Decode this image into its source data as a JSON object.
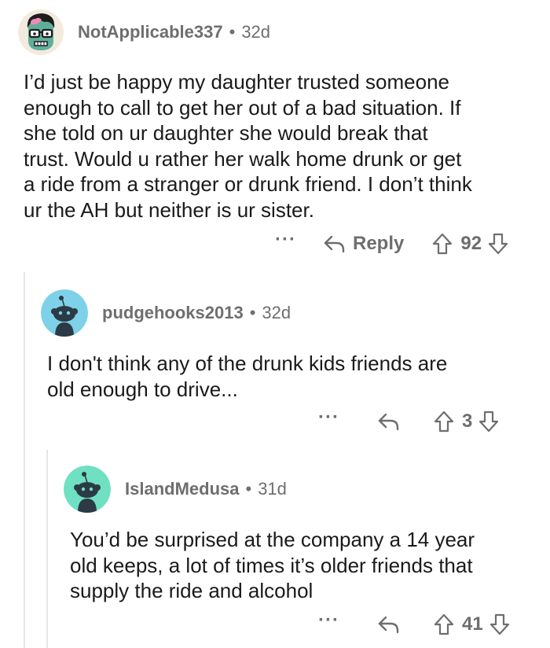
{
  "comments": [
    {
      "username": "NotApplicable337",
      "separator": "•",
      "age": "32d",
      "body": "I’d just be happy my daughter trusted someone\nenough to call to get her out of a bad situation. If\nshe told on ur daughter she would break that\ntrust. Would u rather her walk home drunk or get\na ride from a stranger or drunk friend. I don’t think\nur the AH but neither is ur sister.",
      "more": "···",
      "reply_label": "Reply",
      "score": "92",
      "avatar": "zombie-avatar",
      "avatar_bg": "#f2eadd"
    },
    {
      "username": "pudgehooks2013",
      "separator": "•",
      "age": "32d",
      "body": "I don't think any of the drunk kids friends are\nold enough to drive...",
      "more": "···",
      "score": "3",
      "avatar": "snoo-avatar",
      "avatar_bg": "#7ed1e8"
    },
    {
      "username": "IslandMedusa",
      "separator": "•",
      "age": "31d",
      "body": "You’d be surprised at the company a 14 year\nold keeps, a lot of times it’s older friends that\nsupply the ride and alcohol",
      "more": "···",
      "score": "41",
      "avatar": "snoo-avatar",
      "avatar_bg": "#6fe0c2"
    }
  ],
  "colors": {
    "text": "#1a1a1b",
    "meta": "#6e6e70",
    "thread_line": "#e6e6e6"
  }
}
